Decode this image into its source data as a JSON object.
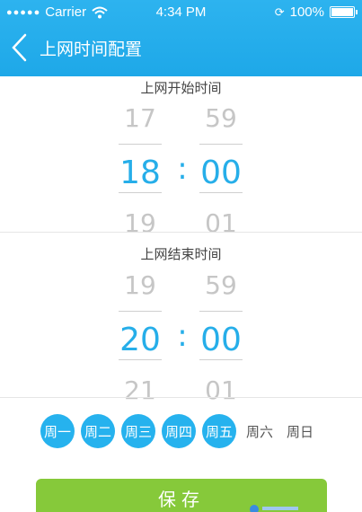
{
  "statusbar": {
    "carrier": "Carrier",
    "time": "4:34 PM",
    "battery": "100%"
  },
  "nav": {
    "title": "上网时间配置"
  },
  "start": {
    "label": "上网开始时间",
    "hour": {
      "prev": "17",
      "current": "18",
      "next": "19"
    },
    "minute": {
      "prev": "59",
      "current": "00",
      "next": "01"
    },
    "separator": ":"
  },
  "end": {
    "label": "上网结束时间",
    "hour": {
      "prev": "19",
      "current": "20",
      "next": "21"
    },
    "minute": {
      "prev": "59",
      "current": "00",
      "next": "01"
    },
    "separator": ":"
  },
  "days": [
    {
      "label": "周一",
      "selected": true
    },
    {
      "label": "周二",
      "selected": true
    },
    {
      "label": "周三",
      "selected": true
    },
    {
      "label": "周四",
      "selected": true
    },
    {
      "label": "周五",
      "selected": true
    },
    {
      "label": "周六",
      "selected": false
    },
    {
      "label": "周日",
      "selected": false
    }
  ],
  "save_label": "保存",
  "colors": {
    "accent": "#26aee9",
    "save": "#86c93a"
  }
}
